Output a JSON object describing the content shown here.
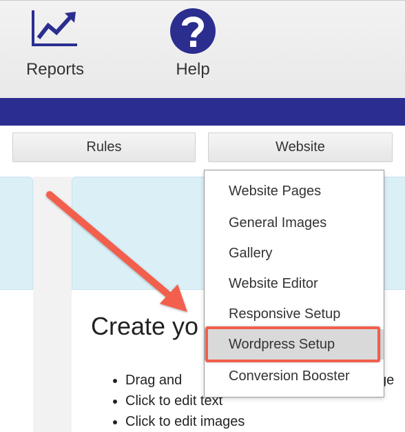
{
  "toolbar": {
    "reports_label": "Reports",
    "help_label": "Help"
  },
  "tabs": {
    "rules": "Rules",
    "website": "Website"
  },
  "dropdown": {
    "items": [
      "Website Pages",
      "General Images",
      "Gallery",
      "Website Editor",
      "Responsive Setup",
      "Wordpress Setup",
      "Conversion Booster"
    ],
    "active_index": 5
  },
  "content": {
    "heading": "Create yo",
    "bullets": [
      "Drag and",
      "Click to edit text",
      "Click to edit images"
    ],
    "bullet_tail": "ge"
  },
  "colors": {
    "brand_bar": "#2b2e8f",
    "icon": "#2b2e8f",
    "annotation": "#f25e4d",
    "panel": "#dbeff7"
  },
  "icons": {
    "reports": "line-chart-icon",
    "help": "question-mark-icon"
  }
}
